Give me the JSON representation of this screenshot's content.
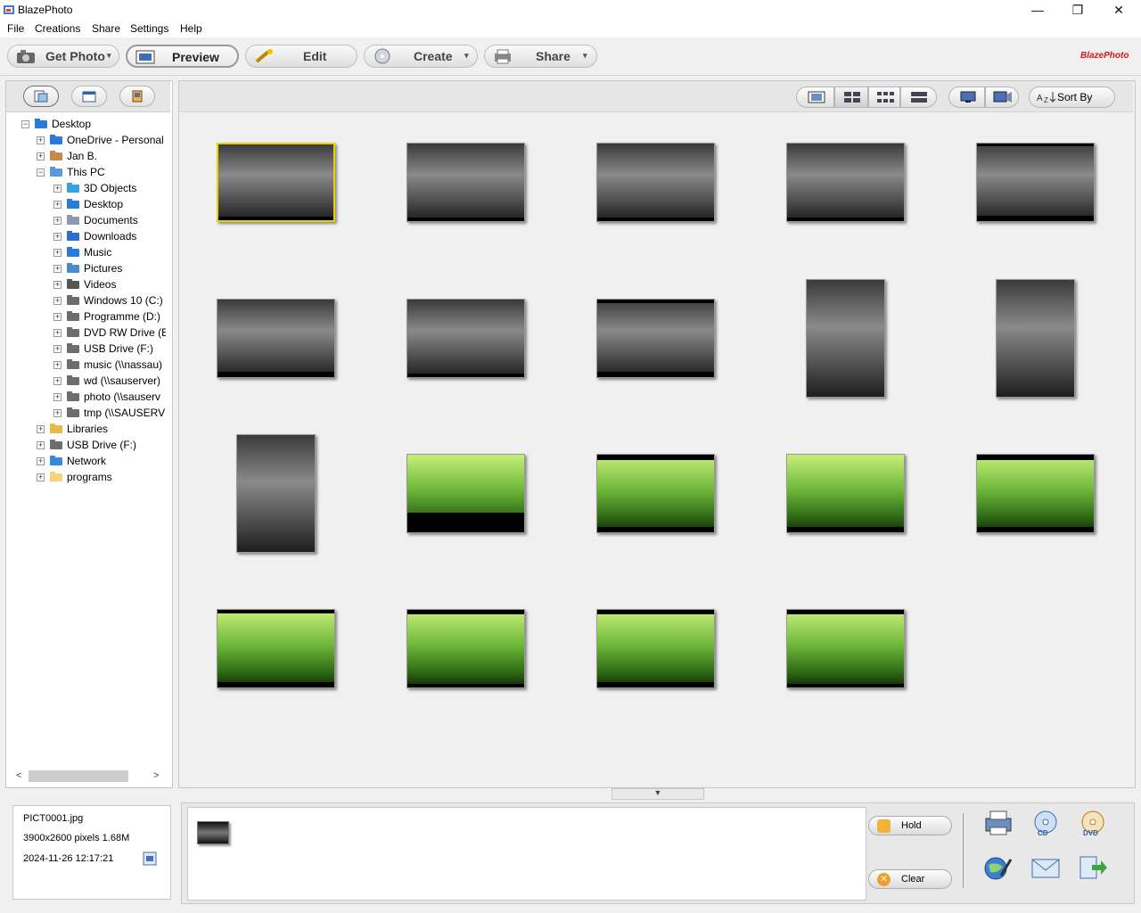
{
  "window": {
    "title": "BlazePhoto",
    "controls": {
      "minimize": "—",
      "maximize": "❐",
      "close": "✕"
    }
  },
  "menu": [
    "File",
    "Creations",
    "Share",
    "Settings",
    "Help"
  ],
  "toolbar": {
    "get_photo": "Get Photo",
    "preview": "Preview",
    "edit": "Edit",
    "create": "Create",
    "share": "Share",
    "brand": "BlazePhoto"
  },
  "view_toolbar": {
    "sort_by": "Sort By"
  },
  "tree": {
    "root": "Desktop",
    "level1a": [
      "OneDrive - Personal",
      "Jan B.",
      "This PC"
    ],
    "thispc": [
      "3D Objects",
      "Desktop",
      "Documents",
      "Downloads",
      "Music",
      "Pictures",
      "Videos",
      "Windows 10 (C:)",
      "Programme (D:)",
      "DVD RW Drive (E:",
      "USB Drive (F:)",
      "music (\\\\nassau)",
      "wd (\\\\sauserver)",
      "photo (\\\\sauserv",
      "tmp (\\\\SAUSERVI"
    ],
    "level1b": [
      "Libraries",
      "USB Drive (F:)",
      "Network",
      "programs"
    ]
  },
  "info": {
    "filename": "PICT0001.jpg",
    "dimensions": "3900x2600 pixels  1.68M",
    "datetime": "2024-11-26 12:17:21"
  },
  "tray": {
    "hold": "Hold",
    "clear": "Clear"
  },
  "colors": {
    "selection": "#e6d400",
    "brand": "#d8141c"
  }
}
